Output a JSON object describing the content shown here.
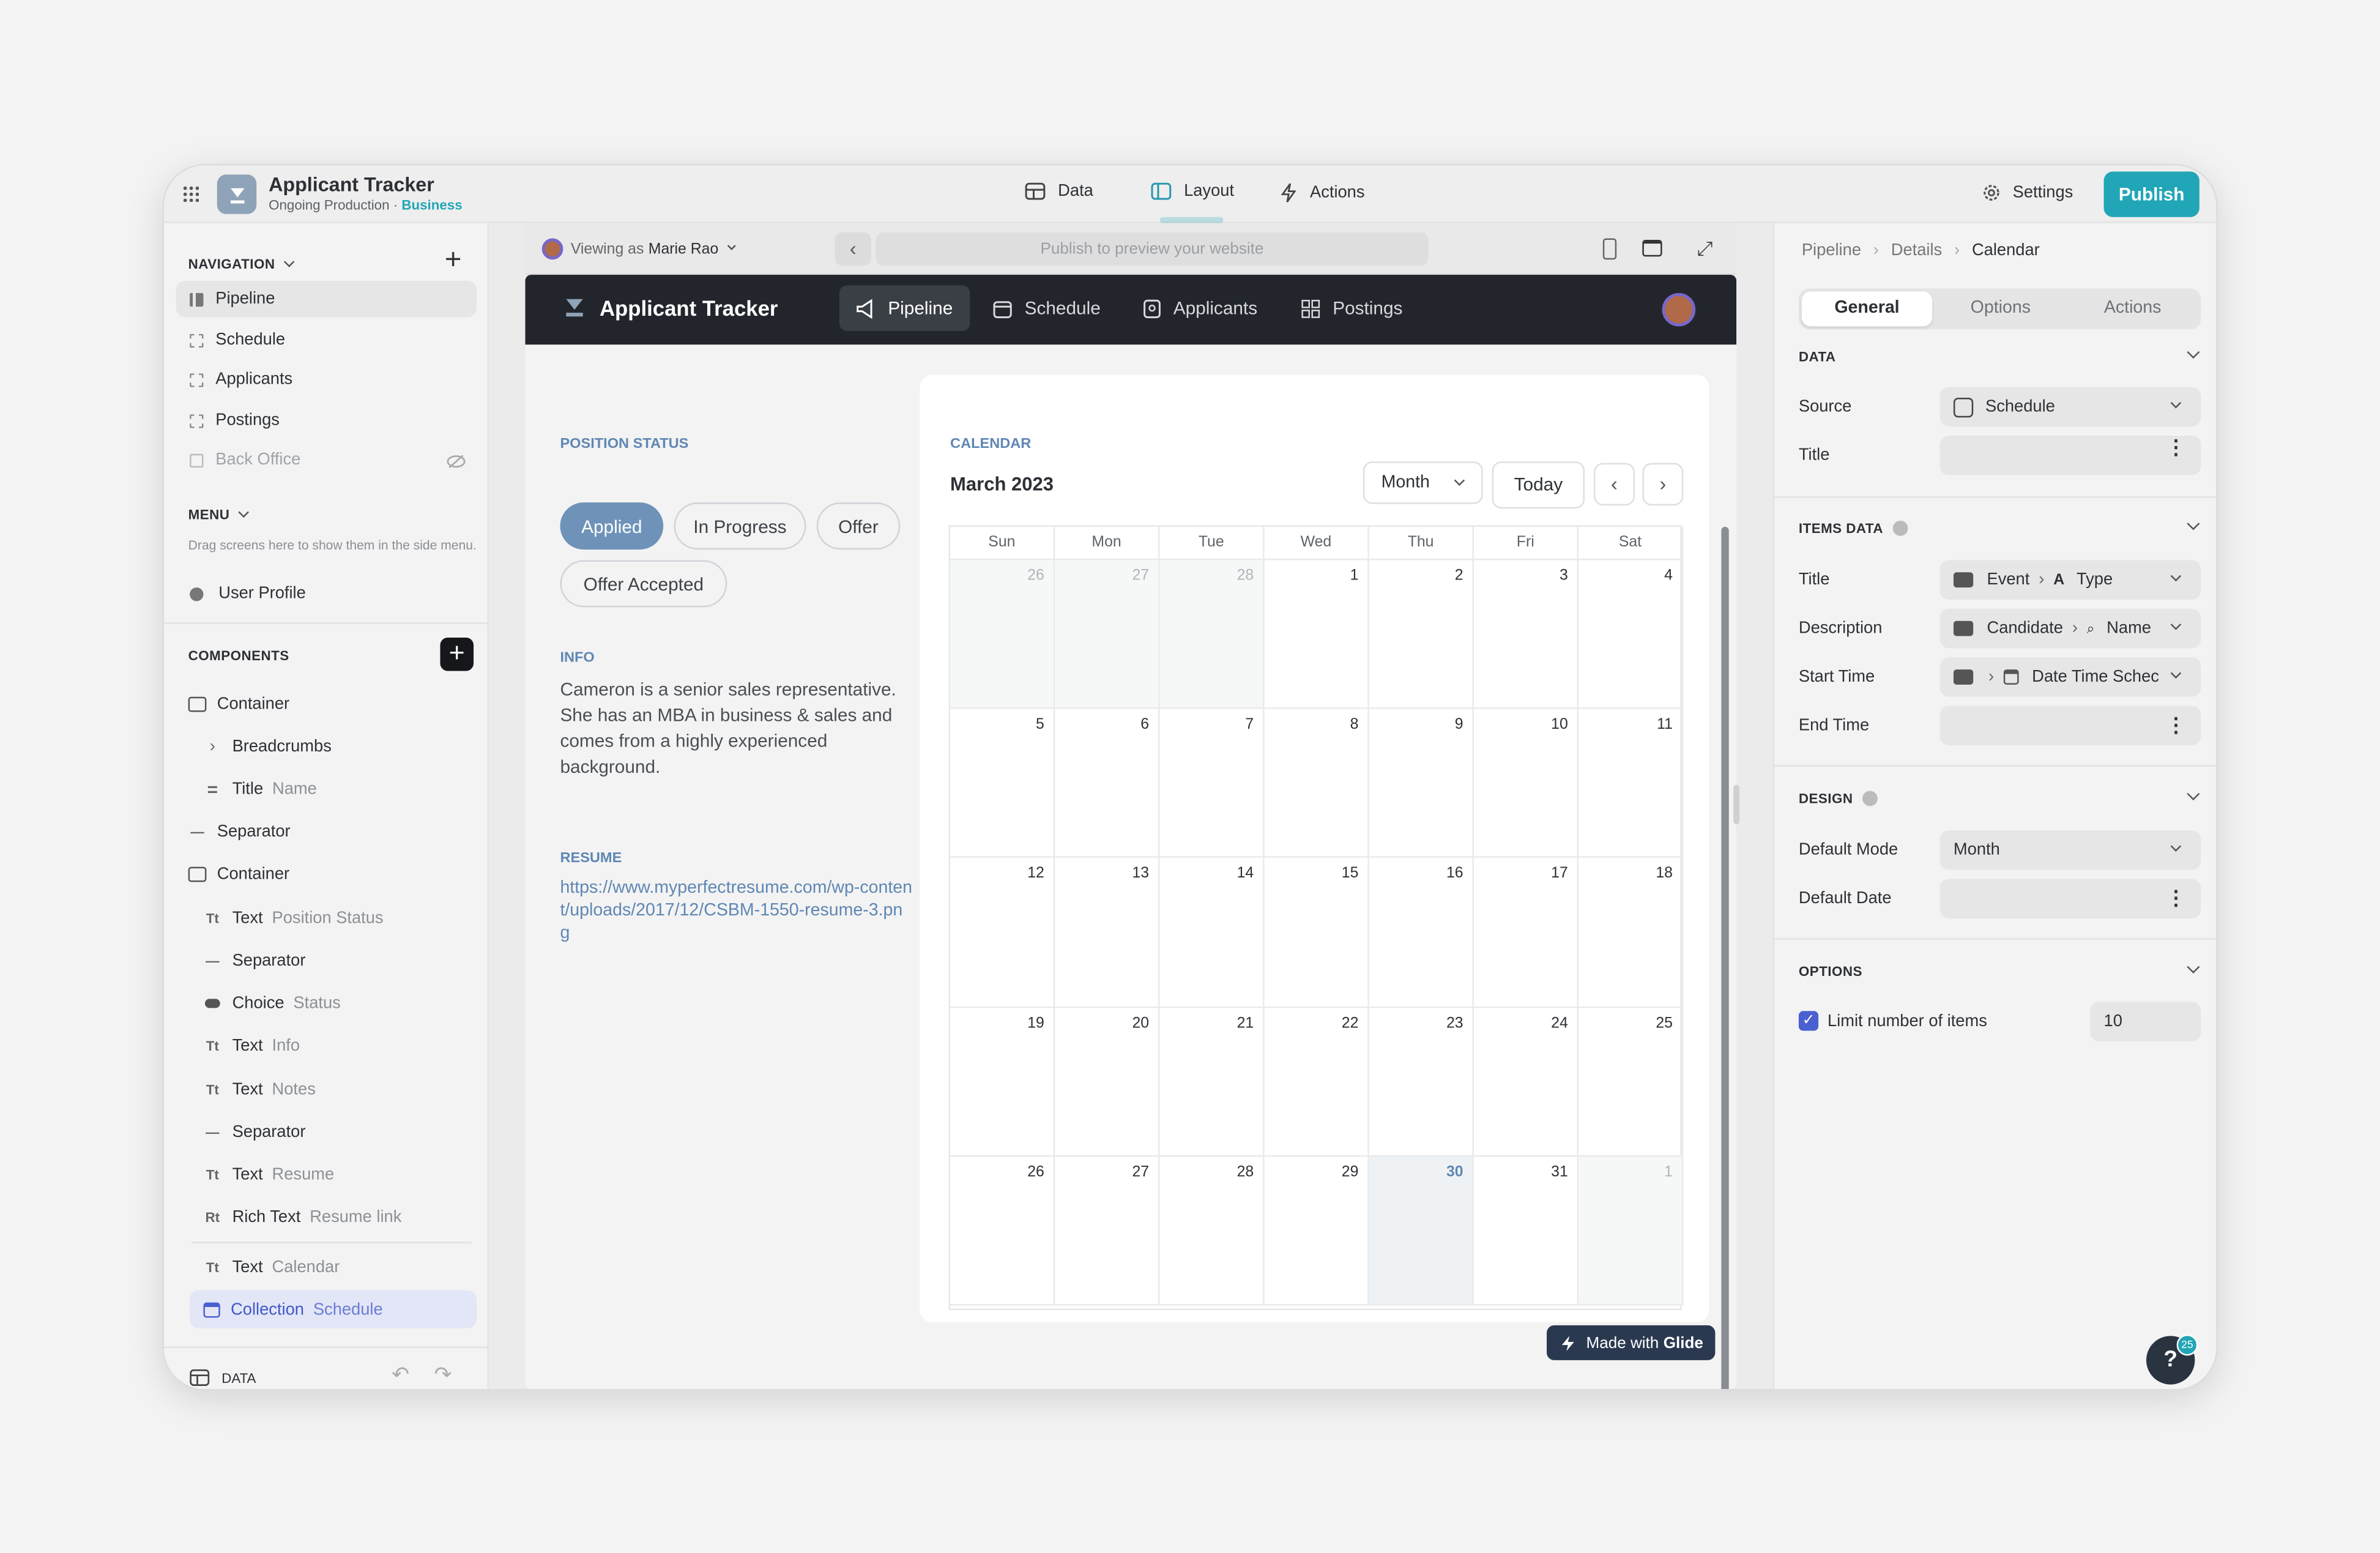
{
  "app": {
    "title": "Applicant Tracker",
    "subtitle": "Ongoing Production · ",
    "plan": "Business"
  },
  "topnav": {
    "data": "Data",
    "layout": "Layout",
    "actions": "Actions",
    "settings": "Settings",
    "publish": "Publish"
  },
  "sidebar": {
    "navigation_label": "NAVIGATION",
    "nav_items": [
      {
        "label": "Pipeline"
      },
      {
        "label": "Schedule"
      },
      {
        "label": "Applicants"
      },
      {
        "label": "Postings"
      },
      {
        "label": "Back Office"
      }
    ],
    "menu_label": "MENU",
    "menu_hint": "Drag screens here to show them in the side menu.",
    "user_profile": "User Profile",
    "components_label": "COMPONENTS",
    "components": [
      {
        "type": "Container",
        "name": ""
      },
      {
        "type": "Breadcrumbs",
        "name": ""
      },
      {
        "type": "Title",
        "name": "Name"
      },
      {
        "type": "Separator",
        "name": ""
      },
      {
        "type": "Container",
        "name": ""
      },
      {
        "type": "Text",
        "name": "Position Status"
      },
      {
        "type": "Separator",
        "name": ""
      },
      {
        "type": "Choice",
        "name": "Status"
      },
      {
        "type": "Text",
        "name": "Info"
      },
      {
        "type": "Text",
        "name": "Notes"
      },
      {
        "type": "Separator",
        "name": ""
      },
      {
        "type": "Text",
        "name": "Resume"
      },
      {
        "type": "Rich Text",
        "name": "Resume link"
      },
      {
        "type": "Text",
        "name": "Calendar"
      },
      {
        "type": "Collection",
        "name": "Schedule"
      }
    ],
    "data_label": "DATA",
    "icon_text": "Tt",
    "icon_rich": "Rt"
  },
  "preview": {
    "viewing_as": "Viewing as ",
    "viewer": "Marie Rao",
    "url_placeholder": "Publish to preview your website",
    "app_name": "Applicant Tracker",
    "tabs": [
      {
        "label": "Pipeline"
      },
      {
        "label": "Schedule"
      },
      {
        "label": "Applicants"
      },
      {
        "label": "Postings"
      }
    ],
    "position_status_label": "POSITION STATUS",
    "choices": [
      "Applied",
      "In Progress",
      "Offer",
      "Offer Accepted"
    ],
    "info_label": "INFO",
    "info_text": "Cameron is a senior sales representative. She has an MBA in business & sales and comes from a highly experienced background.",
    "resume_label": "RESUME",
    "resume_link": "https://www.myperfectresume.com/wp-content/uploads/2017/12/CSBM-1550-resume-3.png",
    "calendar_label": "CALENDAR",
    "month_title": "March 2023",
    "mode": "Month",
    "today_btn": "Today",
    "weekdays": [
      "Sun",
      "Mon",
      "Tue",
      "Wed",
      "Thu",
      "Fri",
      "Sat"
    ],
    "weeks": [
      [
        "26",
        "27",
        "28",
        "1",
        "2",
        "3",
        "4"
      ],
      [
        "5",
        "6",
        "7",
        "8",
        "9",
        "10",
        "11"
      ],
      [
        "12",
        "13",
        "14",
        "15",
        "16",
        "17",
        "18"
      ],
      [
        "19",
        "20",
        "21",
        "22",
        "23",
        "24",
        "25"
      ],
      [
        "26",
        "27",
        "28",
        "29",
        "30",
        "31",
        "1"
      ]
    ],
    "made_with": "Made with ",
    "made_with_brand": "Glide"
  },
  "panel": {
    "breadcrumb": [
      "Pipeline",
      "Details",
      "Calendar"
    ],
    "tabs": [
      "General",
      "Options",
      "Actions"
    ],
    "data_head": "DATA",
    "source_label": "Source",
    "source_value": "Schedule",
    "title_label": "Title",
    "items_head": "ITEMS DATA",
    "items_title_label": "Title",
    "items_title_a": "Event",
    "items_title_b": "Type",
    "desc_label": "Description",
    "desc_a": "Candidate",
    "desc_b": "Name",
    "start_label": "Start Time",
    "start_b": "Date Time Schec",
    "end_label": "End Time",
    "design_head": "DESIGN",
    "mode_label": "Default Mode",
    "mode_value": "Month",
    "date_label": "Default Date",
    "options_head": "OPTIONS",
    "limit_label": "Limit number of items",
    "limit_value": "10",
    "help_badge": "25"
  },
  "colors": {
    "accent": "#21a6b7",
    "choice_selected": "#6f93b8",
    "label_blue": "#5f87b4",
    "selected_item": "#e2e6f7"
  }
}
